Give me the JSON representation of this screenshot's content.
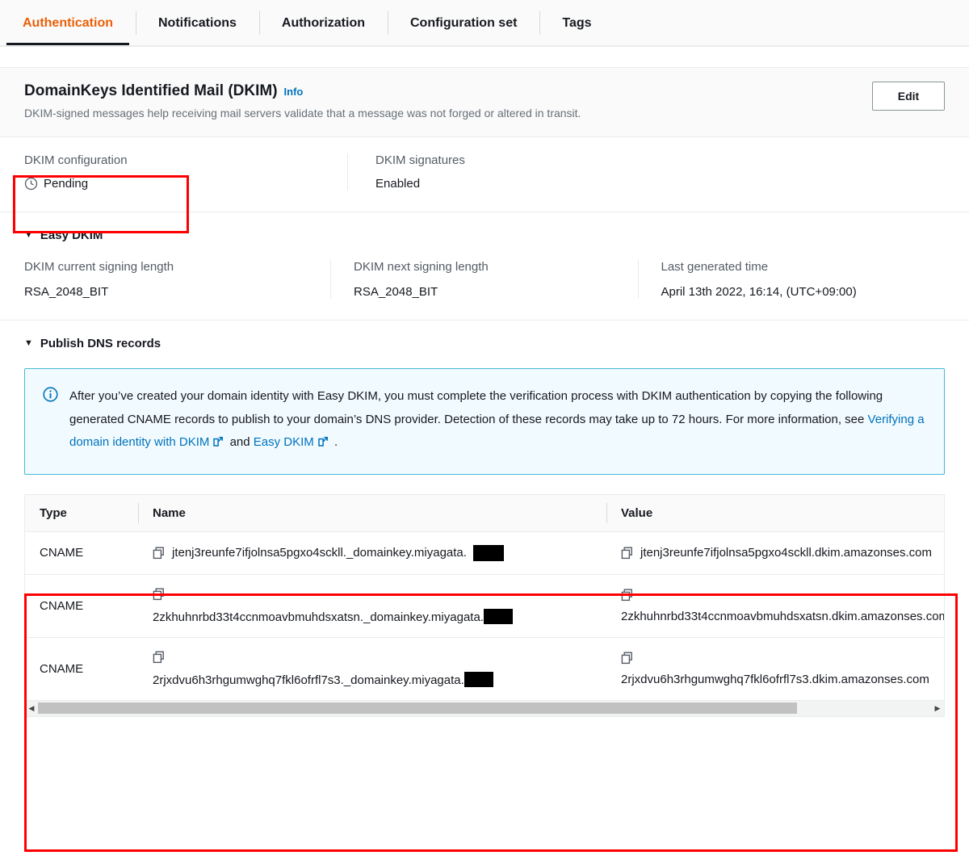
{
  "tabs": [
    {
      "label": "Authentication",
      "active": true
    },
    {
      "label": "Notifications",
      "active": false
    },
    {
      "label": "Authorization",
      "active": false
    },
    {
      "label": "Configuration set",
      "active": false
    },
    {
      "label": "Tags",
      "active": false
    }
  ],
  "panel": {
    "title": "DomainKeys Identified Mail (DKIM)",
    "info_label": "Info",
    "description": "DKIM-signed messages help receiving mail servers validate that a message was not forged or altered in transit.",
    "edit_label": "Edit"
  },
  "status": {
    "dkim_configuration_label": "DKIM configuration",
    "dkim_configuration_value": "Pending",
    "dkim_configuration_icon": "clock-icon",
    "dkim_signatures_label": "DKIM signatures",
    "dkim_signatures_value": "Enabled"
  },
  "easy_dkim": {
    "heading": "Easy DKIM",
    "caret": "▼",
    "current_signing_length_label": "DKIM current signing length",
    "current_signing_length_value": "RSA_2048_BIT",
    "next_signing_length_label": "DKIM next signing length",
    "next_signing_length_value": "RSA_2048_BIT",
    "last_generated_label": "Last generated time",
    "last_generated_value": "April 13th 2022, 16:14, (UTC+09:00)"
  },
  "publish_dns": {
    "heading": "Publish DNS records",
    "caret": "▼",
    "alert": {
      "icon": "info-circle-icon",
      "text_part_1": "After you’ve created your domain identity with Easy DKIM, you must complete the verification process with DKIM authentication by copying the following generated CNAME records to publish to your domain’s DNS provider. Detection of these records may take up to 72 hours. For more information, see ",
      "link_1": "Verifying a domain identity with DKIM",
      "text_between": " and ",
      "link_2": "Easy DKIM",
      "text_end": " ."
    },
    "table": {
      "columns": [
        "Type",
        "Name",
        "Value"
      ],
      "rows": [
        {
          "type": "CNAME",
          "name": "jtenj3reunfe7ifjolnsa5pgxo4sckll._domainkey.miyagata.",
          "name_redacted": true,
          "value": "jtenj3reunfe7ifjolnsa5pgxo4sckll.dkim.amazonses.com",
          "layout": "inline"
        },
        {
          "type": "CNAME",
          "name": "2zkhuhnrbd33t4ccnmoavbmuhdsxatsn._domainkey.miyagata.",
          "name_redacted": true,
          "value": "2zkhuhnrbd33t4ccnmoavbmuhdsxatsn.dkim.amazonses.com",
          "layout": "wrapped"
        },
        {
          "type": "CNAME",
          "name": "2rjxdvu6h3rhgumwghq7fkl6ofrfl7s3._domainkey.miyagata.",
          "name_redacted": true,
          "value": "2rjxdvu6h3rhgumwghq7fkl6ofrfl7s3.dkim.amazonses.com",
          "layout": "wrapped"
        }
      ]
    }
  },
  "colors": {
    "accent_orange": "#eb5f07",
    "link_blue": "#0073bb",
    "annotation_red": "#ff0000",
    "alert_bg": "#f1faff",
    "alert_border": "#44b9d6"
  }
}
